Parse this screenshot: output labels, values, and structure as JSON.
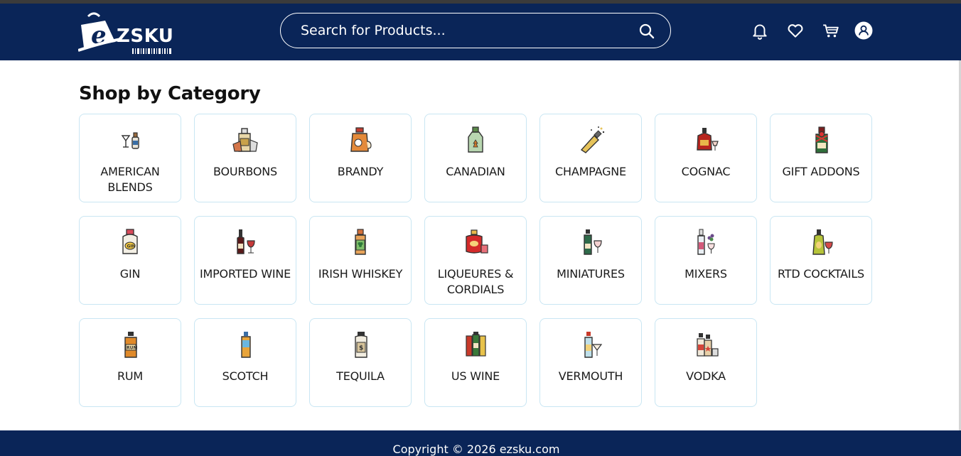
{
  "header": {
    "logo_text": "ZSKU",
    "search_placeholder": "Search for Products...",
    "icons": [
      "bell-icon",
      "heart-icon",
      "cart-icon",
      "user-icon"
    ]
  },
  "main": {
    "title": "Shop by Category",
    "categories": [
      {
        "label": "AMERICAN BLENDS",
        "icon": "cocktail-bottle-icon"
      },
      {
        "label": "BOURBONS",
        "icon": "bourbon-icon"
      },
      {
        "label": "BRANDY",
        "icon": "brandy-icon"
      },
      {
        "label": "CANADIAN",
        "icon": "maple-bottle-icon"
      },
      {
        "label": "CHAMPAGNE",
        "icon": "champagne-icon"
      },
      {
        "label": "COGNAC",
        "icon": "cognac-icon"
      },
      {
        "label": "GIFT ADDONS",
        "icon": "gift-bottle-icon"
      },
      {
        "label": "GIN",
        "icon": "gin-icon"
      },
      {
        "label": "IMPORTED WINE",
        "icon": "wine-icon"
      },
      {
        "label": "IRISH WHISKEY",
        "icon": "shamrock-bottle-icon"
      },
      {
        "label": "LIQUEURES & CORDIALS",
        "icon": "liqueur-icon"
      },
      {
        "label": "MINIATURES",
        "icon": "mini-bottle-icon"
      },
      {
        "label": "MIXERS",
        "icon": "mixer-icon"
      },
      {
        "label": "RTD COCKTAILS",
        "icon": "rtd-cocktail-icon"
      },
      {
        "label": "RUM",
        "icon": "rum-icon"
      },
      {
        "label": "SCOTCH",
        "icon": "scotch-icon"
      },
      {
        "label": "TEQUILA",
        "icon": "tequila-icon"
      },
      {
        "label": "US WINE",
        "icon": "us-wine-icon"
      },
      {
        "label": "VERMOUTH",
        "icon": "vermouth-icon"
      },
      {
        "label": "VODKA",
        "icon": "vodka-icon"
      }
    ]
  },
  "footer": {
    "copyright": "Copyright © 2026 ezsku.com"
  },
  "colors": {
    "header_bg": "#0a2558",
    "card_border": "#c9e6f3",
    "text": "#1a1a1a"
  }
}
